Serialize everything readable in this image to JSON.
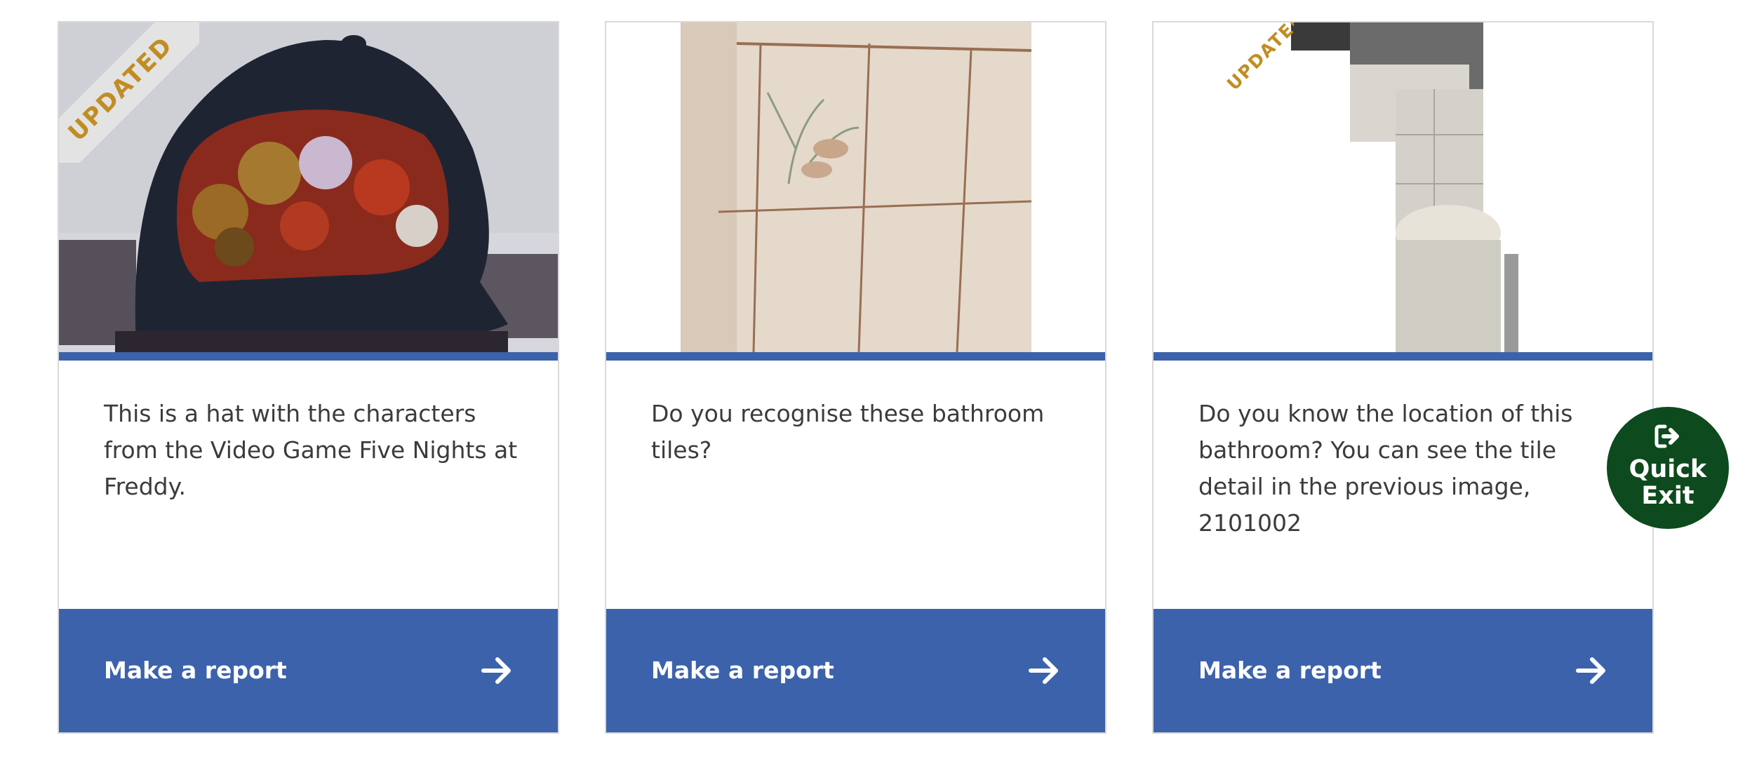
{
  "cards": [
    {
      "badge": "UPDATED",
      "image_alt": "Black cap with Five Nights at Freddy characters",
      "description": "This is a hat with the characters from the Video Game Five Nights at Freddy.",
      "button_label": "Make a report"
    },
    {
      "badge": "",
      "image_alt": "Cream bathroom tiles with lily pattern",
      "description": "Do you recognise these bathroom tiles?",
      "button_label": "Make a report"
    },
    {
      "badge": "UPDATED",
      "image_alt": "Bathroom with bathtub and cream tiles",
      "description": "Do you know the location of this bathroom?  You can see the tile detail in the previous image, 2101002",
      "button_label": "Make a report"
    }
  ],
  "quick_exit": {
    "label": "Quick\nExit",
    "icon": "exit-icon"
  },
  "colors": {
    "accent_blue": "#3c62ac",
    "badge_gold": "#c18d23",
    "quick_exit_green": "#0d4a1d",
    "text": "#3b3b3b"
  }
}
